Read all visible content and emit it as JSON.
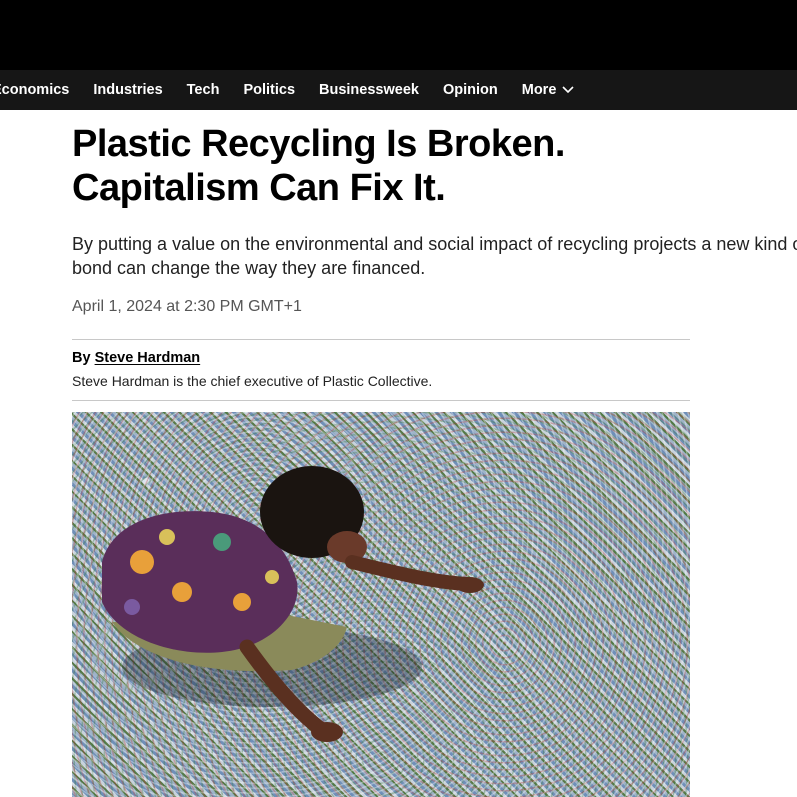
{
  "nav": {
    "items": [
      "Economics",
      "Industries",
      "Tech",
      "Politics",
      "Businessweek",
      "Opinion",
      "More"
    ],
    "more_icon": "chevron-down-icon"
  },
  "article": {
    "headline_line1": "Plastic Recycling Is Broken.",
    "headline_line2": "Capitalism Can Fix It.",
    "dek": "By putting a value on the environmental and social impact of recycling projects a new kind of bond can change the way they are financed.",
    "timestamp": "April 1, 2024 at 2:30 PM GMT+1",
    "byline_prefix": "By",
    "author": "Steve Hardman",
    "author_bio": "Steve Hardman is the chief executive of Plastic Collective."
  },
  "colors": {
    "topbar": "#000000",
    "navbar": "#161616",
    "nav_text": "#ffffff",
    "timestamp": "#555555"
  }
}
